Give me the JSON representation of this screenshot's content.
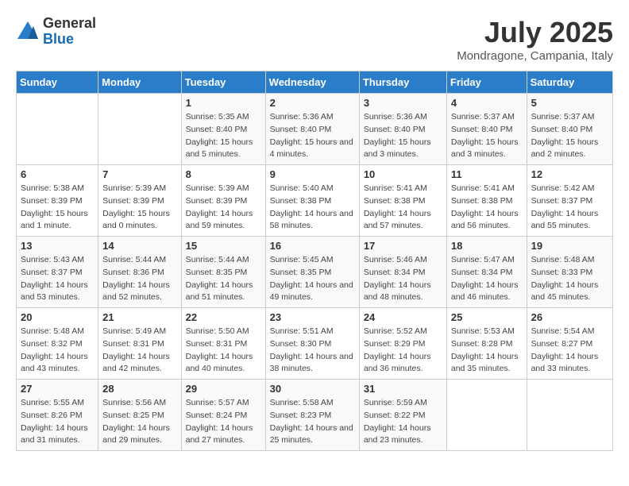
{
  "header": {
    "logo_general": "General",
    "logo_blue": "Blue",
    "month_year": "July 2025",
    "location": "Mondragone, Campania, Italy"
  },
  "days_of_week": [
    "Sunday",
    "Monday",
    "Tuesday",
    "Wednesday",
    "Thursday",
    "Friday",
    "Saturday"
  ],
  "weeks": [
    [
      {
        "day": "",
        "info": ""
      },
      {
        "day": "",
        "info": ""
      },
      {
        "day": "1",
        "info": "Sunrise: 5:35 AM\nSunset: 8:40 PM\nDaylight: 15 hours and 5 minutes."
      },
      {
        "day": "2",
        "info": "Sunrise: 5:36 AM\nSunset: 8:40 PM\nDaylight: 15 hours and 4 minutes."
      },
      {
        "day": "3",
        "info": "Sunrise: 5:36 AM\nSunset: 8:40 PM\nDaylight: 15 hours and 3 minutes."
      },
      {
        "day": "4",
        "info": "Sunrise: 5:37 AM\nSunset: 8:40 PM\nDaylight: 15 hours and 3 minutes."
      },
      {
        "day": "5",
        "info": "Sunrise: 5:37 AM\nSunset: 8:40 PM\nDaylight: 15 hours and 2 minutes."
      }
    ],
    [
      {
        "day": "6",
        "info": "Sunrise: 5:38 AM\nSunset: 8:39 PM\nDaylight: 15 hours and 1 minute."
      },
      {
        "day": "7",
        "info": "Sunrise: 5:39 AM\nSunset: 8:39 PM\nDaylight: 15 hours and 0 minutes."
      },
      {
        "day": "8",
        "info": "Sunrise: 5:39 AM\nSunset: 8:39 PM\nDaylight: 14 hours and 59 minutes."
      },
      {
        "day": "9",
        "info": "Sunrise: 5:40 AM\nSunset: 8:38 PM\nDaylight: 14 hours and 58 minutes."
      },
      {
        "day": "10",
        "info": "Sunrise: 5:41 AM\nSunset: 8:38 PM\nDaylight: 14 hours and 57 minutes."
      },
      {
        "day": "11",
        "info": "Sunrise: 5:41 AM\nSunset: 8:38 PM\nDaylight: 14 hours and 56 minutes."
      },
      {
        "day": "12",
        "info": "Sunrise: 5:42 AM\nSunset: 8:37 PM\nDaylight: 14 hours and 55 minutes."
      }
    ],
    [
      {
        "day": "13",
        "info": "Sunrise: 5:43 AM\nSunset: 8:37 PM\nDaylight: 14 hours and 53 minutes."
      },
      {
        "day": "14",
        "info": "Sunrise: 5:44 AM\nSunset: 8:36 PM\nDaylight: 14 hours and 52 minutes."
      },
      {
        "day": "15",
        "info": "Sunrise: 5:44 AM\nSunset: 8:35 PM\nDaylight: 14 hours and 51 minutes."
      },
      {
        "day": "16",
        "info": "Sunrise: 5:45 AM\nSunset: 8:35 PM\nDaylight: 14 hours and 49 minutes."
      },
      {
        "day": "17",
        "info": "Sunrise: 5:46 AM\nSunset: 8:34 PM\nDaylight: 14 hours and 48 minutes."
      },
      {
        "day": "18",
        "info": "Sunrise: 5:47 AM\nSunset: 8:34 PM\nDaylight: 14 hours and 46 minutes."
      },
      {
        "day": "19",
        "info": "Sunrise: 5:48 AM\nSunset: 8:33 PM\nDaylight: 14 hours and 45 minutes."
      }
    ],
    [
      {
        "day": "20",
        "info": "Sunrise: 5:48 AM\nSunset: 8:32 PM\nDaylight: 14 hours and 43 minutes."
      },
      {
        "day": "21",
        "info": "Sunrise: 5:49 AM\nSunset: 8:31 PM\nDaylight: 14 hours and 42 minutes."
      },
      {
        "day": "22",
        "info": "Sunrise: 5:50 AM\nSunset: 8:31 PM\nDaylight: 14 hours and 40 minutes."
      },
      {
        "day": "23",
        "info": "Sunrise: 5:51 AM\nSunset: 8:30 PM\nDaylight: 14 hours and 38 minutes."
      },
      {
        "day": "24",
        "info": "Sunrise: 5:52 AM\nSunset: 8:29 PM\nDaylight: 14 hours and 36 minutes."
      },
      {
        "day": "25",
        "info": "Sunrise: 5:53 AM\nSunset: 8:28 PM\nDaylight: 14 hours and 35 minutes."
      },
      {
        "day": "26",
        "info": "Sunrise: 5:54 AM\nSunset: 8:27 PM\nDaylight: 14 hours and 33 minutes."
      }
    ],
    [
      {
        "day": "27",
        "info": "Sunrise: 5:55 AM\nSunset: 8:26 PM\nDaylight: 14 hours and 31 minutes."
      },
      {
        "day": "28",
        "info": "Sunrise: 5:56 AM\nSunset: 8:25 PM\nDaylight: 14 hours and 29 minutes."
      },
      {
        "day": "29",
        "info": "Sunrise: 5:57 AM\nSunset: 8:24 PM\nDaylight: 14 hours and 27 minutes."
      },
      {
        "day": "30",
        "info": "Sunrise: 5:58 AM\nSunset: 8:23 PM\nDaylight: 14 hours and 25 minutes."
      },
      {
        "day": "31",
        "info": "Sunrise: 5:59 AM\nSunset: 8:22 PM\nDaylight: 14 hours and 23 minutes."
      },
      {
        "day": "",
        "info": ""
      },
      {
        "day": "",
        "info": ""
      }
    ]
  ]
}
